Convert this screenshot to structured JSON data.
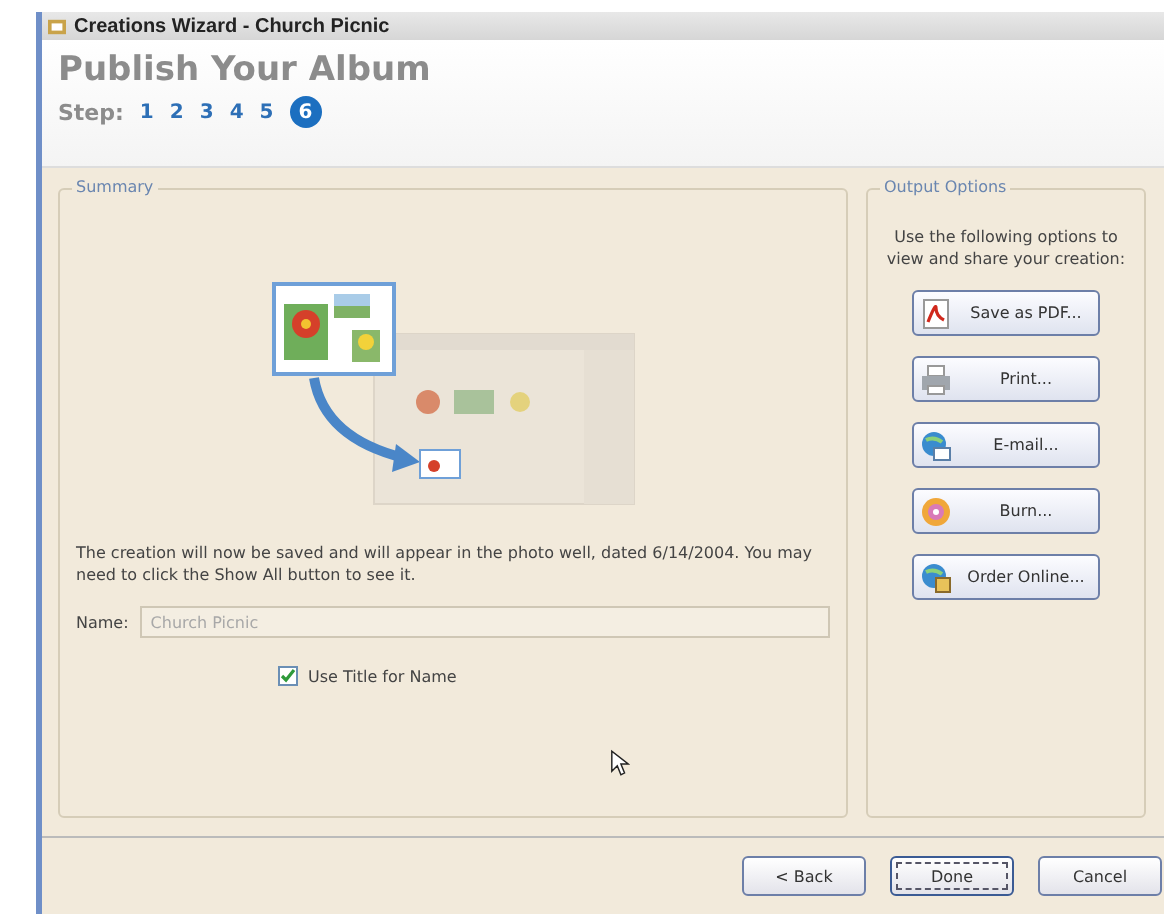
{
  "window": {
    "title": "Creations Wizard - Church Picnic"
  },
  "header": {
    "title": "Publish Your Album",
    "step_label": "Step:",
    "steps": [
      {
        "label": "1",
        "selected": false
      },
      {
        "label": "2",
        "selected": false
      },
      {
        "label": "3",
        "selected": false
      },
      {
        "label": "4",
        "selected": false
      },
      {
        "label": "5",
        "selected": false
      },
      {
        "label": "6",
        "selected": true
      }
    ]
  },
  "summary": {
    "legend": "Summary",
    "message": "The creation will now be saved and will appear in the photo well, dated 6/14/2004. You may need to click the Show All button to see it.",
    "name_label": "Name:",
    "name_value": "Church Picnic",
    "checkbox": {
      "label": "Use Title for Name",
      "checked": true
    }
  },
  "output_options": {
    "legend": "Output Options",
    "intro": "Use the following options to view and share your creation:",
    "buttons": [
      {
        "label": "Save as PDF...",
        "kind": "pdf"
      },
      {
        "label": "Print...",
        "kind": "print"
      },
      {
        "label": "E-mail...",
        "kind": "email"
      },
      {
        "label": "Burn...",
        "kind": "burn"
      },
      {
        "label": "Order Online...",
        "kind": "order"
      }
    ]
  },
  "footer": {
    "buttons": [
      {
        "label": "< Back",
        "kind": "normal"
      },
      {
        "label": "Done",
        "kind": "default"
      },
      {
        "label": "Cancel",
        "kind": "normal"
      }
    ]
  }
}
